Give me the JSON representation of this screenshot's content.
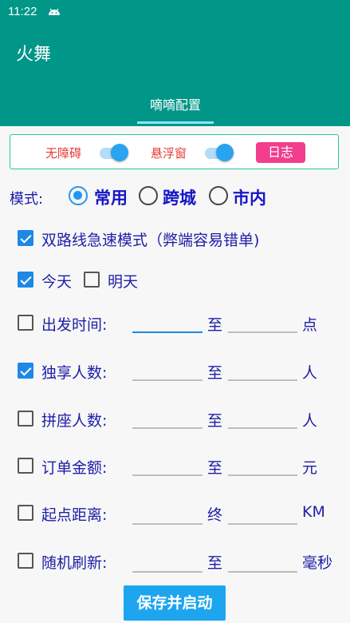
{
  "status_bar": {
    "time": "11:22"
  },
  "app": {
    "title": "火舞",
    "tab": "嘀嘀配置"
  },
  "panel": {
    "switch1_label": "无障碍",
    "switch2_label": "悬浮窗",
    "log_button": "日志"
  },
  "mode": {
    "label": "模式:",
    "options": [
      "常用",
      "跨城",
      "市内"
    ],
    "selected": "常用"
  },
  "dual_route": {
    "label": "双路线急速模式（弊端容易错单)",
    "checked": true
  },
  "days": {
    "today": "今天",
    "tomorrow": "明天",
    "today_checked": true,
    "tomorrow_checked": false
  },
  "filters": [
    {
      "label": "出发时间:",
      "sep": "至",
      "unit": "点",
      "checked": false,
      "from": "",
      "to": ""
    },
    {
      "label": "独享人数:",
      "sep": "至",
      "unit": "人",
      "checked": true,
      "from": "",
      "to": ""
    },
    {
      "label": "拼座人数:",
      "sep": "至",
      "unit": "人",
      "checked": false,
      "from": "",
      "to": ""
    },
    {
      "label": "订单金额:",
      "sep": "至",
      "unit": "元",
      "checked": false,
      "from": "",
      "to": ""
    },
    {
      "label": "起点距离:",
      "sep": "终",
      "unit": "KM",
      "checked": false,
      "from": "",
      "to": ""
    },
    {
      "label": "随机刷新:",
      "sep": "至",
      "unit": "毫秒",
      "checked": false,
      "from": "",
      "to": ""
    }
  ],
  "save_button": "保存并启动",
  "colors": {
    "primary": "#009688",
    "accent": "#1e88e5",
    "pink": "#f23e8c",
    "label_text": "#1e1ea8",
    "warn_text": "#e53935"
  }
}
